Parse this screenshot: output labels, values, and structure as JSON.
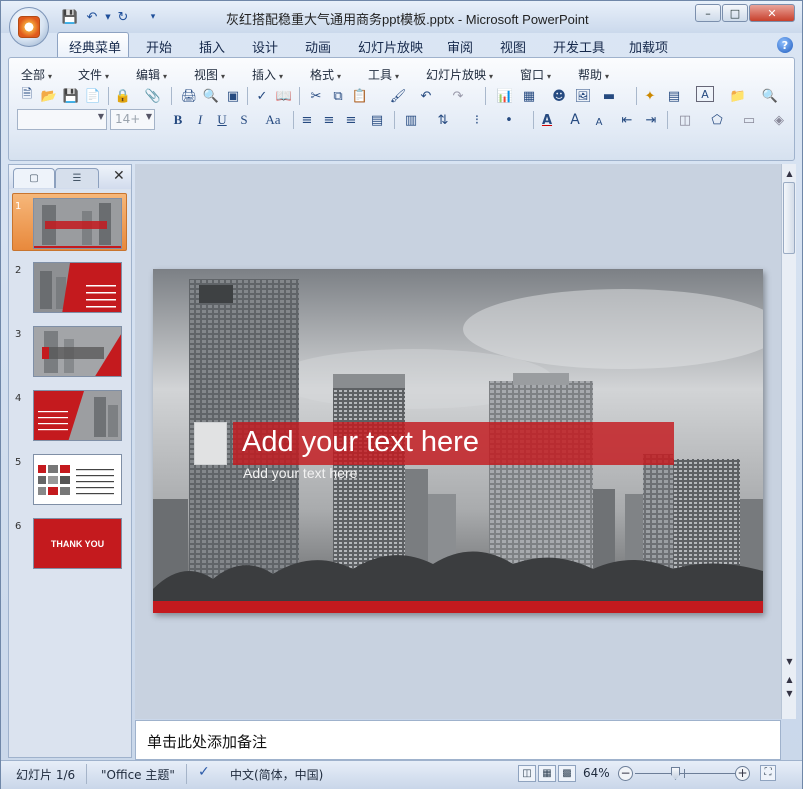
{
  "window": {
    "title": "灰红搭配稳重大气通用商务ppt模板.pptx - Microsoft PowerPoint",
    "controls": {
      "minimize": "–",
      "maximize": "□",
      "close": "✕"
    }
  },
  "ribbon_tabs": [
    "经典菜单",
    "开始",
    "插入",
    "设计",
    "动画",
    "幻灯片放映",
    "审阅",
    "视图",
    "开发工具",
    "加载项"
  ],
  "classic_menu": [
    "全部",
    "文件",
    "编辑",
    "视图",
    "插入",
    "格式",
    "工具",
    "幻灯片放映",
    "窗口",
    "帮助"
  ],
  "format_bar": {
    "font_name": "",
    "font_size": "14+",
    "bold": "B",
    "italic": "I",
    "underline": "U",
    "strike": "S",
    "case": "Aa",
    "font_color": "A",
    "grow": "A",
    "shrink": "A"
  },
  "slide_panel": {
    "tabs": [
      "slides-tab",
      "outline-tab"
    ],
    "close": "✕",
    "selected_index": 1,
    "thumbnails": [
      {
        "number": "1",
        "caption": "Add your text here"
      },
      {
        "number": "2",
        "caption": "CONTENT"
      },
      {
        "number": "3",
        "caption": "1"
      },
      {
        "number": "4",
        "caption": "Add your text here"
      },
      {
        "number": "5",
        "caption": ""
      },
      {
        "number": "6",
        "caption": "THANK YOU"
      }
    ]
  },
  "slide": {
    "title": "Add your text here",
    "subtitle": "Add your text here",
    "accent_color": "#c41a1e"
  },
  "notes": {
    "placeholder": "单击此处添加备注"
  },
  "status": {
    "slide_info": "幻灯片 1/6",
    "theme": "\"Office 主题\"",
    "language": "中文(简体，中国)",
    "zoom": "64%",
    "zoom_fraction": 0.4
  }
}
